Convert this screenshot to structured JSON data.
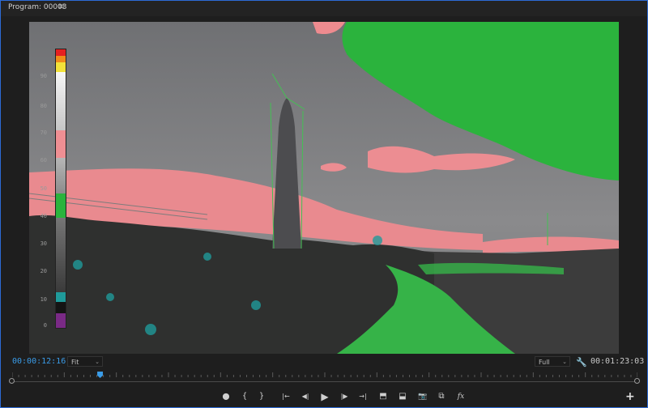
{
  "panel": {
    "title": "Program: 00003",
    "menu_icon": "≡"
  },
  "viewer": {
    "ire_labels": [
      "90",
      "80",
      "70",
      "60",
      "50",
      "40",
      "30",
      "20",
      "10",
      "0"
    ]
  },
  "controls": {
    "timecode_current": "00:00:12:16",
    "zoom_label": "Fit",
    "resolution_label": "Full",
    "timecode_duration": "00:01:23:03",
    "playhead_fraction": 0.14
  },
  "transport": {
    "marker_icon": "⬤",
    "in_icon": "{",
    "out_icon": "}",
    "goto_in_icon": "|←",
    "step_back_icon": "◀|",
    "play_icon": "▶",
    "step_forward_icon": "|▶",
    "goto_out_icon": "→|",
    "lift_icon": "⬒",
    "extract_icon": "⬓",
    "export_frame_icon": "📷",
    "compare_icon": "⧉",
    "fx_icon": "fx",
    "add_icon": "+"
  }
}
